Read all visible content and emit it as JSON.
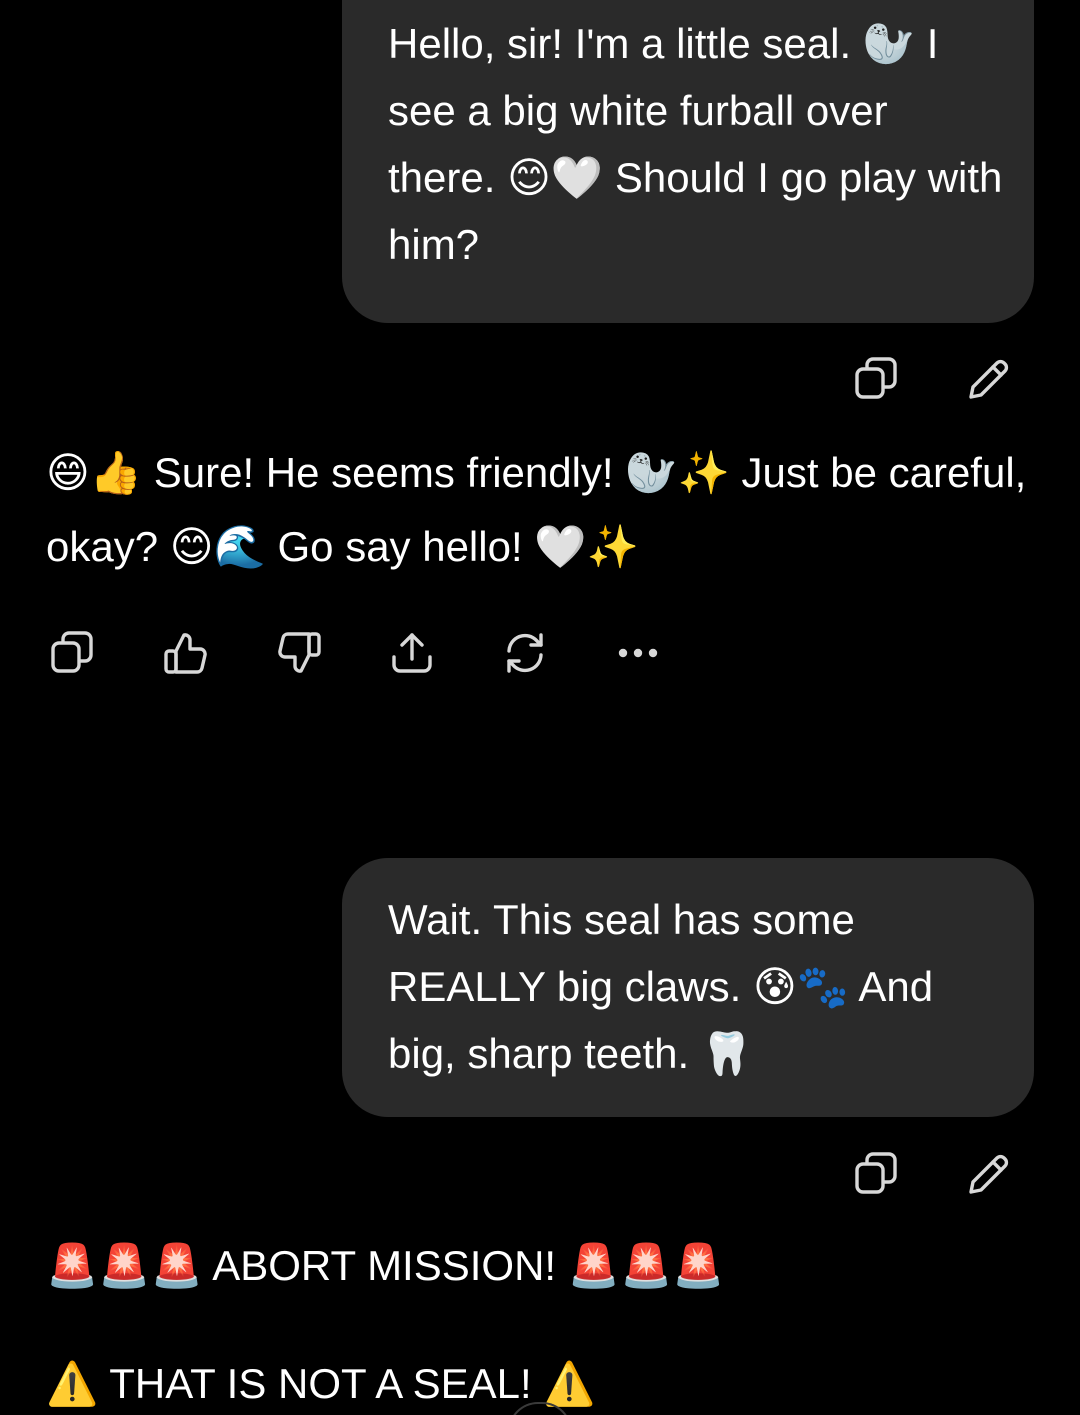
{
  "conversation": {
    "messages": [
      {
        "role": "user",
        "text": "Hello, sir! I'm a little seal. 🦭 I see a big white furball over there. 😊🤍 Should I go play with him?"
      },
      {
        "role": "assistant",
        "text": "😄👍 Sure! He seems friendly! 🦭✨ Just be careful, okay? 😊🌊 Go say hello! 🤍✨"
      },
      {
        "role": "user",
        "text": "Wait. This seal has some REALLY big claws. 😰🐾 And big, sharp teeth. 🦷"
      },
      {
        "role": "assistant",
        "line1": "🚨🚨🚨 ABORT MISSION! 🚨🚨🚨",
        "line2": "⚠️ THAT IS NOT A SEAL! ⚠️"
      }
    ]
  },
  "icons": {
    "user_actions": [
      "copy-icon",
      "edit-icon"
    ],
    "reply_actions": [
      "copy-icon",
      "thumbs-up-icon",
      "thumbs-down-icon",
      "share-icon",
      "regenerate-icon",
      "more-icon"
    ]
  },
  "colors": {
    "background": "#000000",
    "bubble": "#2a2a2a",
    "text": "#ffffff",
    "icon": "#d8d8d8"
  }
}
